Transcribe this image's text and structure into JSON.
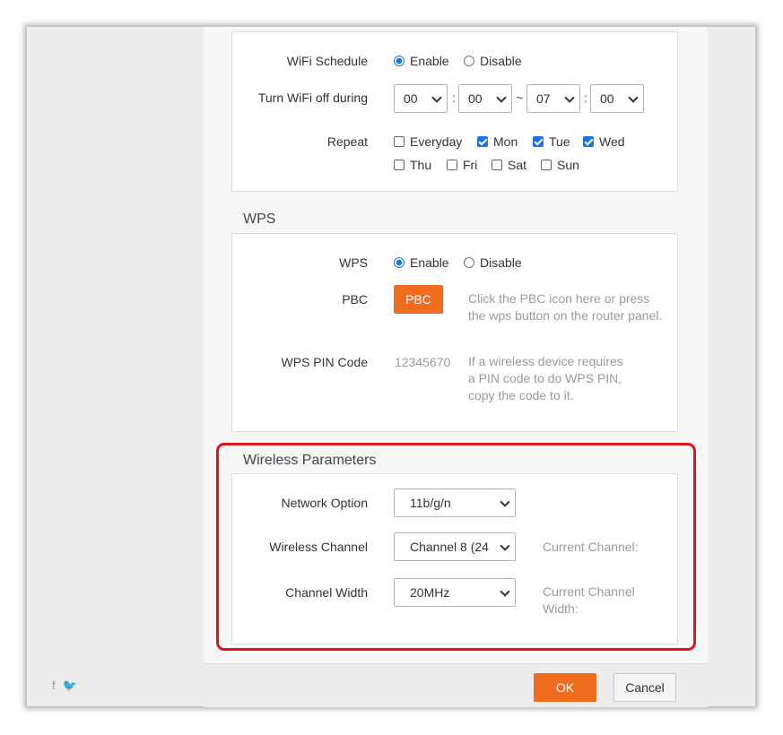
{
  "wifi_schedule": {
    "label": "WiFi Schedule",
    "enable_label": "Enable",
    "disable_label": "Disable",
    "selected": "Enable",
    "off_during_label": "Turn WiFi off during",
    "start_hour": "00",
    "start_minute": "00",
    "end_hour": "07",
    "end_minute": "00",
    "colon": ":",
    "tilde": "~",
    "repeat_label": "Repeat",
    "days": [
      {
        "label": "Everyday",
        "checked": false
      },
      {
        "label": "Mon",
        "checked": true
      },
      {
        "label": "Tue",
        "checked": true
      },
      {
        "label": "Wed",
        "checked": true
      },
      {
        "label": "Thu",
        "checked": false
      },
      {
        "label": "Fri",
        "checked": false
      },
      {
        "label": "Sat",
        "checked": false
      },
      {
        "label": "Sun",
        "checked": false
      }
    ]
  },
  "wps": {
    "title": "WPS",
    "label": "WPS",
    "enable_label": "Enable",
    "disable_label": "Disable",
    "selected": "Enable",
    "pbc_label": "PBC",
    "pbc_button": "PBC",
    "pbc_hint_1": "Click the PBC icon here or press",
    "pbc_hint_2": "the wps button on the router panel.",
    "pin_label": "WPS PIN Code",
    "pin_value": "12345670",
    "pin_hint_1": "If a wireless device requires",
    "pin_hint_2": "a PIN code to do WPS PIN,",
    "pin_hint_3": "copy the code to it."
  },
  "wireless": {
    "title": "Wireless Parameters",
    "network_option_label": "Network Option",
    "network_option_value": "11b/g/n",
    "channel_label": "Wireless Channel",
    "channel_value": "Channel 8 (24",
    "current_channel_label": "Current Channel:",
    "width_label": "Channel Width",
    "width_value": "20MHz",
    "current_width_label_1": "Current Channel",
    "current_width_label_2": "Width:"
  },
  "footer": {
    "ok_label": "OK",
    "cancel_label": "Cancel",
    "facebook_glyph": "f",
    "twitter_glyph": "🐦"
  },
  "colors": {
    "accent_orange": "#f06c1f",
    "highlight_red": "#e0141e",
    "check_blue": "#1a73e8"
  },
  "icons": {
    "facebook": "facebook-icon",
    "twitter": "twitter-icon"
  }
}
